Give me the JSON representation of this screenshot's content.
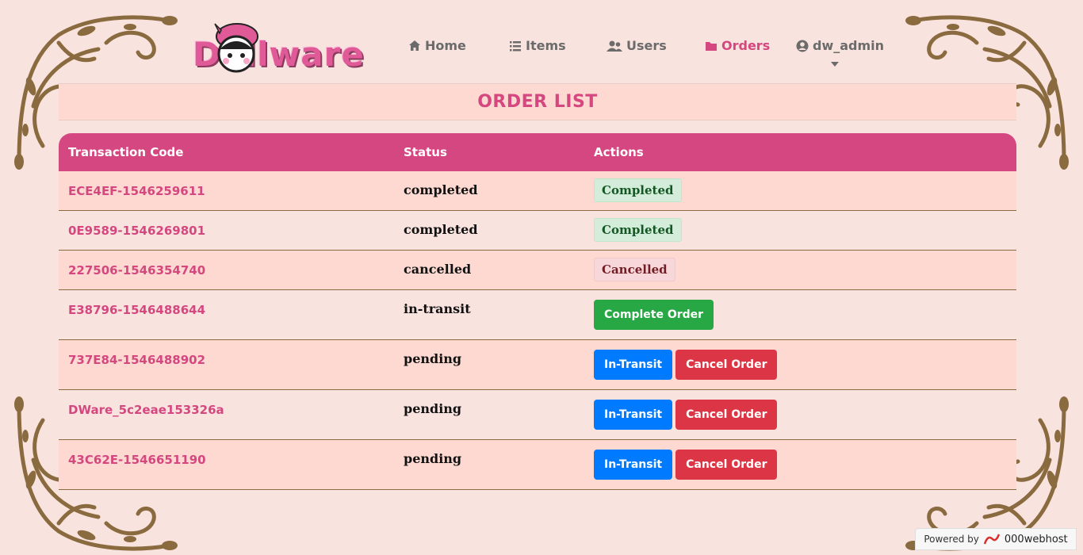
{
  "brand": {
    "logo_text": "Dollware"
  },
  "nav": {
    "items": [
      {
        "label": "Home",
        "icon": "home-icon"
      },
      {
        "label": "Items",
        "icon": "list-icon"
      },
      {
        "label": "Users",
        "icon": "users-icon"
      },
      {
        "label": "Orders",
        "icon": "folder-icon",
        "active": true
      },
      {
        "label": "dw_admin",
        "icon": "user-circle-icon"
      }
    ]
  },
  "page": {
    "title": "ORDER LIST"
  },
  "table": {
    "headers": [
      "Transaction Code",
      "Status",
      "Actions"
    ],
    "rows": [
      {
        "code": "ECE4EF-1546259611",
        "status": "completed",
        "badge": "Completed"
      },
      {
        "code": "0E9589-1546269801",
        "status": "completed",
        "badge": "Completed"
      },
      {
        "code": "227506-1546354740",
        "status": "cancelled",
        "badge": "Cancelled"
      },
      {
        "code": "E38796-1546488644",
        "status": "in-transit",
        "button1": "Complete Order"
      },
      {
        "code": "737E84-1546488902",
        "status": "pending",
        "button1": "In-Transit",
        "button2": "Cancel Order"
      },
      {
        "code": "DWare_5c2eae153326a",
        "status": "pending",
        "button1": "In-Transit",
        "button2": "Cancel Order"
      },
      {
        "code": "43C62E-1546651190",
        "status": "pending",
        "button1": "In-Transit",
        "button2": "Cancel Order"
      }
    ]
  },
  "footer": {
    "powered_by": "Powered by",
    "host": "000webhost"
  },
  "colors": {
    "accent": "#d4477f",
    "header_bg": "#d44781",
    "row_odd": "#fed9d1",
    "row_even": "#f9e3df",
    "ornament": "#8a6a3f"
  }
}
